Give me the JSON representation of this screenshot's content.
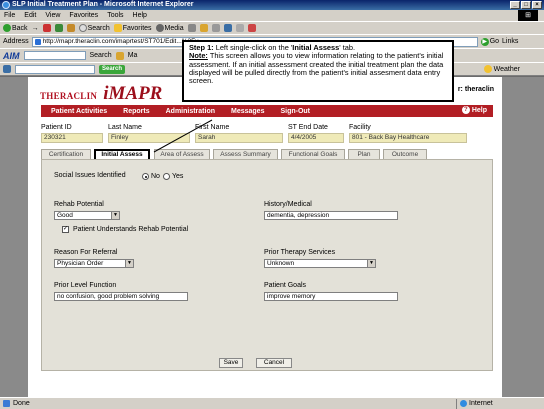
{
  "window": {
    "title": "SLP Initial Treatment Plan - Microsoft Internet Explorer",
    "menu": [
      "File",
      "Edit",
      "View",
      "Favorites",
      "Tools",
      "Help"
    ]
  },
  "toolbar": {
    "back": "Back",
    "search": "Search",
    "favorites": "Favorites",
    "media": "Media"
  },
  "address": {
    "label": "Address",
    "url": "http://mapr.theraclin.com/imaprtest/ST701/Edit...%2Fv",
    "go": "Go",
    "links": "Links"
  },
  "aim": {
    "logo": "AIM",
    "search": "Search",
    "mail": "Ma"
  },
  "linksbar": {
    "search_btn": "Search",
    "weather": "Weather"
  },
  "app": {
    "brand_thera": "THERACLIN",
    "brand_imapr": "iMAPR",
    "user": "r: theraclin",
    "nav": [
      "Patient Activities",
      "Reports",
      "Administration",
      "Messages",
      "Sign-Out"
    ],
    "help": "Help"
  },
  "patient": {
    "id_label": "Patient ID",
    "id": "230321",
    "last_label": "Last Name",
    "last": "Finley",
    "first_label": "First Name",
    "first": "Sarah",
    "st_end_label": "ST End Date",
    "st_end": "4/4/2005",
    "facility_label": "Facility",
    "facility": "801 - Back Bay Healthcare"
  },
  "tabs": [
    "Certification",
    "Initial Assess",
    "Area of Assess",
    "Assess Summary",
    "Functional Goals",
    "Plan",
    "Outcome"
  ],
  "form": {
    "social_label": "Social Issues Identified",
    "social_no": "No",
    "social_yes": "Yes",
    "rehab_label": "Rehab Potential",
    "rehab_value": "Good",
    "understands_label": "Patient Understands Rehab Potential",
    "history_label": "History/Medical",
    "history_value": "dementia, depression",
    "referral_label": "Reason For Referral",
    "referral_value": "Physician Order",
    "prior_therapy_label": "Prior Therapy Services",
    "prior_therapy_value": "Unknown",
    "prior_level_label": "Prior Level Function",
    "prior_level_value": "no confusion, good problem solving",
    "goals_label": "Patient Goals",
    "goals_value": "improve memory",
    "save": "Save",
    "cancel": "Cancel"
  },
  "callout": {
    "step": "Step 1:",
    "step_text": "Left single-click on the '",
    "step_target": "Initial Assess",
    "step_tail": "' tab.",
    "note": "Note:",
    "note_text": "This screen allows you to view information relating to the patient's initial assessment. If an initial assessment created the initial treatment plan the data displayed will be pulled directly from the patient's initial assesment data entry screen."
  },
  "status": {
    "left": "Done",
    "zone": "Internet"
  }
}
